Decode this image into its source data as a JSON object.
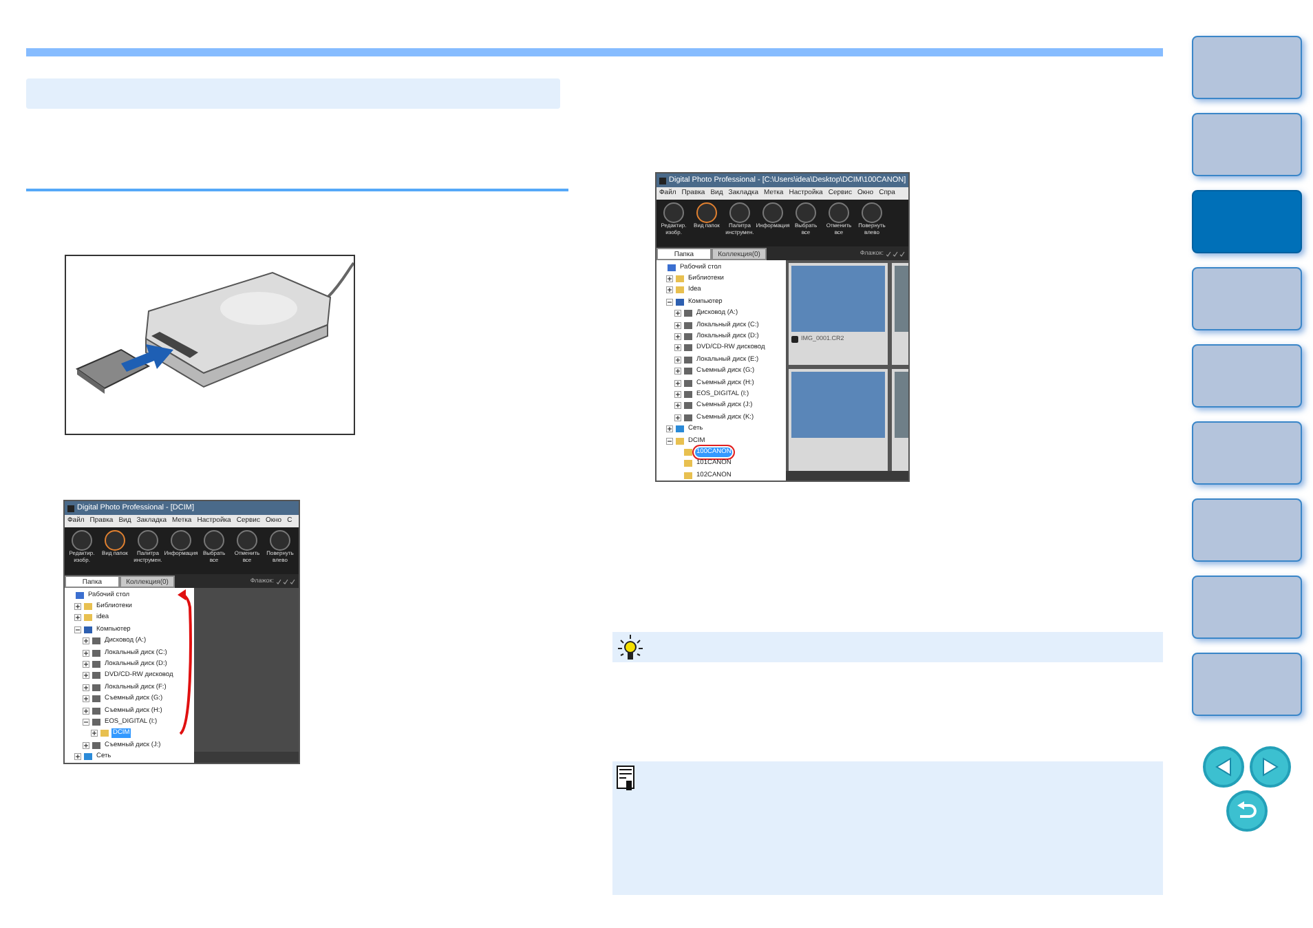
{
  "side_tabs": [
    {
      "selected": false
    },
    {
      "selected": false
    },
    {
      "selected": true
    },
    {
      "selected": false
    },
    {
      "selected": false
    },
    {
      "selected": false
    },
    {
      "selected": false
    },
    {
      "selected": false
    },
    {
      "selected": false
    }
  ],
  "app_window_1": {
    "title": "Digital Photo Professional - [DCIM]",
    "menu": [
      "Файл",
      "Правка",
      "Вид",
      "Закладка",
      "Метка",
      "Настройка",
      "Сервис",
      "Окно",
      "С"
    ],
    "toolbar": [
      {
        "label": "Редактир. изобр.",
        "selected": false
      },
      {
        "label": "Вид папок",
        "selected": true
      },
      {
        "label": "Палитра инструмен.",
        "selected": false
      },
      {
        "label": "Информация",
        "selected": false
      },
      {
        "label": "Выбрать все",
        "selected": false
      },
      {
        "label": "Отменить все",
        "selected": false
      },
      {
        "label": "Повернуть влево",
        "selected": false
      }
    ],
    "tabs": [
      {
        "label": "Папка",
        "selected": true
      },
      {
        "label": "Коллекция(0)",
        "selected": false
      }
    ],
    "flag_label": "Флажок:",
    "tree": [
      {
        "label": "Рабочий стол",
        "kind": "desktop",
        "selected": false,
        "children": [
          {
            "label": "Библиотеки",
            "kind": "folder",
            "expanded": false,
            "selected": false
          },
          {
            "label": "idea",
            "kind": "folder",
            "expanded": false,
            "selected": false
          },
          {
            "label": "Компьютер",
            "kind": "computer",
            "expanded": true,
            "selected": false,
            "children": [
              {
                "label": "Дисковод (A:)",
                "kind": "drive",
                "expanded": false,
                "selected": false
              },
              {
                "label": "Локальный диск (C:)",
                "kind": "drive",
                "expanded": false,
                "selected": false
              },
              {
                "label": "Локальный диск (D:)",
                "kind": "drive",
                "expanded": false,
                "selected": false
              },
              {
                "label": "DVD/CD-RW дисковод",
                "kind": "drive",
                "expanded": false,
                "selected": false
              },
              {
                "label": "Локальный диск (F:)",
                "kind": "drive",
                "expanded": false,
                "selected": false
              },
              {
                "label": "Съемный диск (G:)",
                "kind": "drive",
                "expanded": false,
                "selected": false
              },
              {
                "label": "Съемный диск (H:)",
                "kind": "drive",
                "expanded": false,
                "selected": false
              },
              {
                "label": "EOS_DIGITAL (I:)",
                "kind": "drive",
                "expanded": true,
                "selected": false,
                "children": [
                  {
                    "label": "DCIM",
                    "kind": "folder",
                    "expanded": false,
                    "selected": true
                  }
                ]
              },
              {
                "label": "Съемный диск (J:)",
                "kind": "drive",
                "expanded": false,
                "selected": false
              }
            ]
          },
          {
            "label": "Сеть",
            "kind": "network",
            "expanded": false,
            "selected": false
          }
        ]
      }
    ]
  },
  "app_window_2": {
    "title": "Digital Photo Professional - [C:\\Users\\idea\\Desktop\\DCIM\\100CANON]",
    "menu": [
      "Файл",
      "Правка",
      "Вид",
      "Закладка",
      "Метка",
      "Настройка",
      "Сервис",
      "Окно",
      "Спра"
    ],
    "toolbar": [
      {
        "label": "Редактир. изобр.",
        "selected": false
      },
      {
        "label": "Вид папок",
        "selected": true
      },
      {
        "label": "Палитра инструмен.",
        "selected": false
      },
      {
        "label": "Информация",
        "selected": false
      },
      {
        "label": "Выбрать все",
        "selected": false
      },
      {
        "label": "Отменить все",
        "selected": false
      },
      {
        "label": "Повернуть влево",
        "selected": false
      }
    ],
    "tabs": [
      {
        "label": "Папка",
        "selected": true
      },
      {
        "label": "Коллекция(0)",
        "selected": false
      }
    ],
    "flag_label": "Флажок:",
    "tree": [
      {
        "label": "Рабочий стол",
        "kind": "desktop",
        "selected": false,
        "children": [
          {
            "label": "Библиотеки",
            "kind": "folder",
            "expanded": false,
            "selected": false
          },
          {
            "label": "Idea",
            "kind": "folder",
            "expanded": false,
            "selected": false
          },
          {
            "label": "Компьютер",
            "kind": "computer",
            "expanded": true,
            "selected": false,
            "children": [
              {
                "label": "Дисковод (A:)",
                "kind": "drive",
                "expanded": false,
                "selected": false
              },
              {
                "label": "Локальный диск (C:)",
                "kind": "drive",
                "expanded": false,
                "selected": false
              },
              {
                "label": "Локальный диск (D:)",
                "kind": "drive",
                "expanded": false,
                "selected": false
              },
              {
                "label": "DVD/CD-RW дисковод",
                "kind": "drive",
                "expanded": false,
                "selected": false
              },
              {
                "label": "Локальный диск (E:)",
                "kind": "drive",
                "expanded": false,
                "selected": false
              },
              {
                "label": "Съемный диск (G:)",
                "kind": "drive",
                "expanded": false,
                "selected": false
              },
              {
                "label": "Съемный диск (H:)",
                "kind": "drive",
                "expanded": false,
                "selected": false
              },
              {
                "label": "EOS_DIGITAL (I:)",
                "kind": "drive",
                "expanded": false,
                "selected": false
              },
              {
                "label": "Съемный диск (J:)",
                "kind": "drive",
                "expanded": false,
                "selected": false
              },
              {
                "label": "Съемный диск (K:)",
                "kind": "drive",
                "expanded": false,
                "selected": false
              }
            ]
          },
          {
            "label": "Сеть",
            "kind": "network",
            "expanded": false,
            "selected": false
          },
          {
            "label": "DCIM",
            "kind": "folder",
            "expanded": true,
            "selected": false,
            "children": [
              {
                "label": "100CANON",
                "kind": "folder",
                "selected": true,
                "circled": true
              },
              {
                "label": "101CANON",
                "kind": "folder",
                "selected": false,
                "circled": false
              },
              {
                "label": "102CANON",
                "kind": "folder",
                "selected": false,
                "circled": false
              }
            ]
          }
        ]
      }
    ],
    "thumbnail_captions": [
      "IMG_0001.CR2"
    ]
  }
}
